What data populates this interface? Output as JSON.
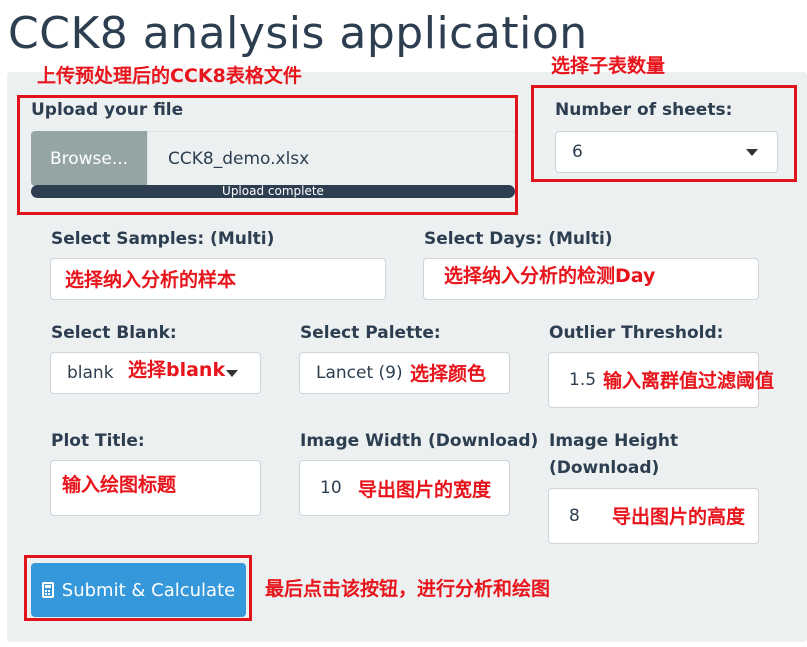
{
  "app": {
    "title": "CCK8 analysis application"
  },
  "upload": {
    "label": "Upload your file",
    "browse_label": "Browse...",
    "file_name": "CCK8_demo.xlsx",
    "status": "Upload complete",
    "progress_percent": 100
  },
  "sheets": {
    "label": "Number of sheets:",
    "value": "6"
  },
  "samples": {
    "label": "Select Samples: (Multi)",
    "value": ""
  },
  "days": {
    "label": "Select Days: (Multi)",
    "value": ""
  },
  "blank": {
    "label": "Select Blank:",
    "value": "blank"
  },
  "palette": {
    "label": "Select Palette:",
    "value": "Lancet (9)"
  },
  "outlier": {
    "label": "Outlier Threshold:",
    "value": "1.5"
  },
  "plot_title": {
    "label": "Plot Title:",
    "value": ""
  },
  "image_width": {
    "label": "Image Width (Download)",
    "value": "10"
  },
  "image_height": {
    "label_line1": "Image Height",
    "label_line2": "(Download)",
    "value": "8"
  },
  "submit": {
    "label": "Submit & Calculate",
    "icon": "calculator-icon"
  },
  "annotations": {
    "upload": "上传预处理后的CCK8表格文件",
    "sheets": "选择子表数量",
    "samples": "选择纳入分析的样本",
    "days": "选择纳入分析的检测Day",
    "blank": "选择blank",
    "palette": "选择颜色",
    "outlier": "输入离群值过滤阈值",
    "plot_title": "输入绘图标题",
    "image_width": "导出图片的宽度",
    "image_height": "导出图片的高度",
    "submit": "最后点击该按钮，进行分析和绘图"
  },
  "colors": {
    "annotation": "#e1141b",
    "primary": "#3498db",
    "dark": "#2c3e50",
    "panel": "#ecf0f1"
  }
}
